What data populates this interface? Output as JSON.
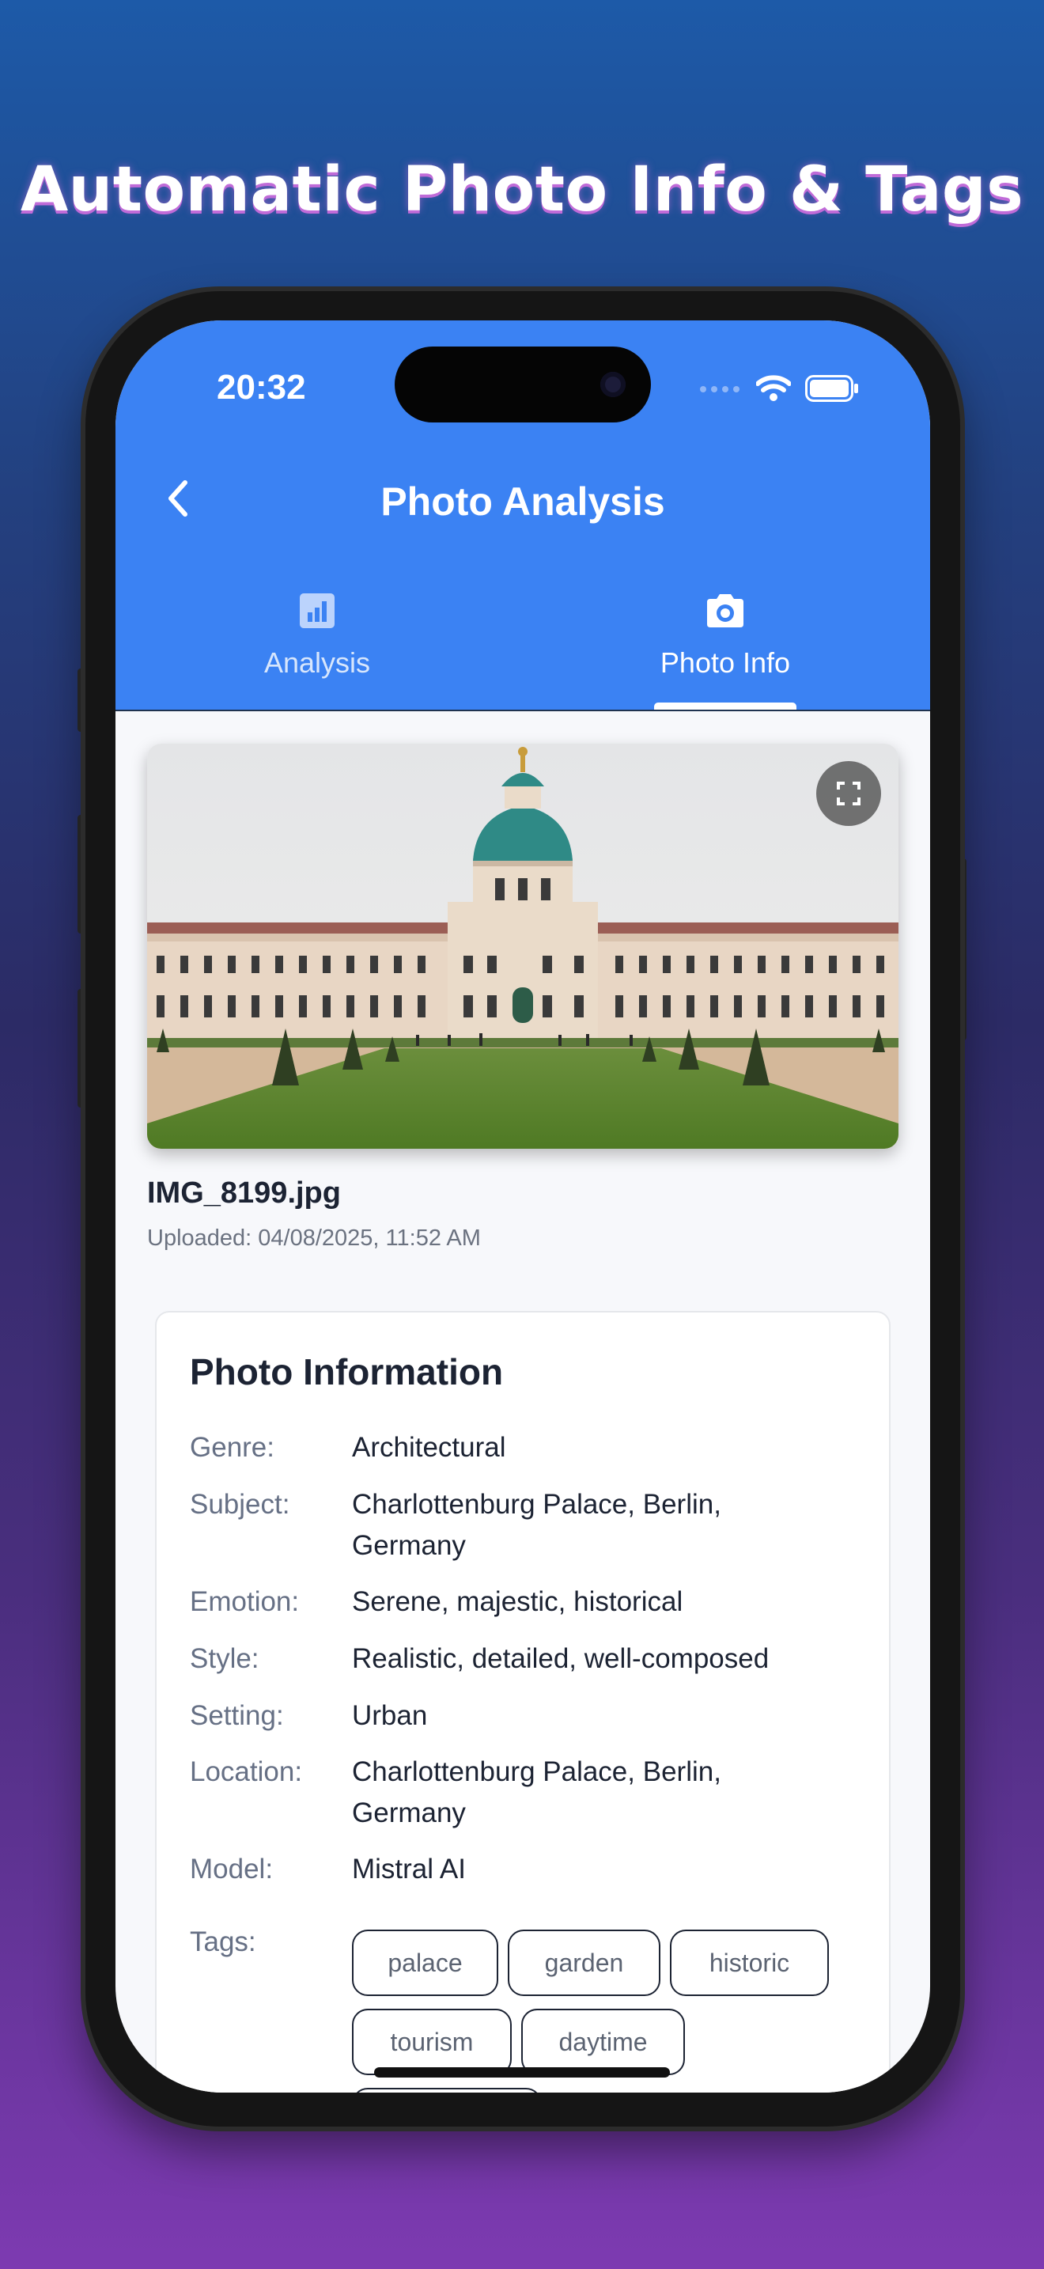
{
  "headline": "Automatic Photo Info & Tags",
  "status_bar": {
    "time": "20:32"
  },
  "nav": {
    "title": "Photo Analysis"
  },
  "tabs": [
    {
      "label": "Analysis",
      "icon": "bar-chart-icon",
      "active": false
    },
    {
      "label": "Photo Info",
      "icon": "camera-icon",
      "active": true
    }
  ],
  "photo": {
    "filename": "IMG_8199.jpg",
    "uploaded": "Uploaded: 04/08/2025, 11:52 AM"
  },
  "info": {
    "title": "Photo Information",
    "rows": [
      {
        "label": "Genre:",
        "value": "Architectural"
      },
      {
        "label": "Subject:",
        "value": "Charlottenburg Palace, Berlin, Germany"
      },
      {
        "label": "Emotion:",
        "value": "Serene, majestic, historical"
      },
      {
        "label": "Style:",
        "value": "Realistic, detailed, well-composed"
      },
      {
        "label": "Setting:",
        "value": "Urban"
      },
      {
        "label": "Location:",
        "value": "Charlottenburg Palace, Berlin, Germany"
      },
      {
        "label": "Model:",
        "value": "Mistral AI"
      }
    ],
    "tags_label": "Tags:",
    "tags": [
      "palace",
      "garden",
      "historic",
      "tourism",
      "daytime"
    ]
  },
  "colors": {
    "accent": "#3b82f3",
    "text": "#1c2333",
    "muted": "#667085"
  }
}
